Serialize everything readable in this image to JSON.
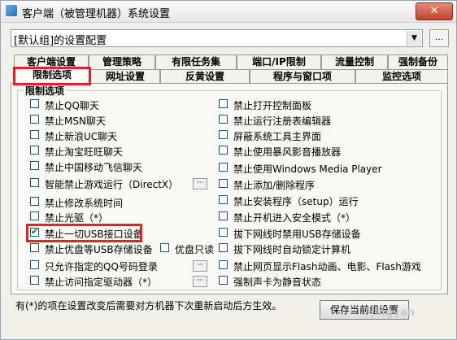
{
  "window": {
    "title": "客户端（被管理机器）系统设置",
    "close_label": "✕"
  },
  "config": {
    "selected": "[默认组]的设置配置",
    "browse_label": "..."
  },
  "tabs_row1": [
    "客户端设置",
    "管理策略",
    "有限任务集",
    "端口/IP限制",
    "流量控制",
    "强制备份"
  ],
  "tabs_row2": [
    "限制选项",
    "网址设置",
    "反黄设置",
    "程序与窗口项",
    "监控选项"
  ],
  "active_tab": "限制选项",
  "group_title": "限制选项",
  "left_options": [
    {
      "label": "禁止QQ聊天",
      "checked": false
    },
    {
      "label": "禁止MSN聊天",
      "checked": false
    },
    {
      "label": "禁止新浪UC聊天",
      "checked": false
    },
    {
      "label": "禁止淘宝旺旺聊天",
      "checked": false
    },
    {
      "label": "禁止中国移动飞信聊天",
      "checked": false
    },
    {
      "label": "智能禁止游戏运行（DirectX）",
      "checked": false
    },
    {
      "label": "禁止修改系统时间",
      "checked": false
    },
    {
      "label": "禁止光驱（*）",
      "checked": false
    },
    {
      "label": "禁止一切USB接口设备",
      "checked": true
    },
    {
      "label": "禁止优盘等USB存储设备",
      "checked": false
    },
    {
      "label": "只允许指定的QQ号码登录",
      "checked": false
    },
    {
      "label": "禁止访问指定驱动器（*）",
      "checked": false
    }
  ],
  "usb_readonly": {
    "label": "优盘只读",
    "checked": false
  },
  "right_options": [
    {
      "label": "禁止打开控制面板",
      "checked": false
    },
    {
      "label": "禁止运行注册表编辑器",
      "checked": false
    },
    {
      "label": "屏蔽系统工具主界面",
      "checked": false
    },
    {
      "label": "禁止使用暴风影音播放器",
      "checked": false
    },
    {
      "label": "禁止使用Windows Media Player",
      "checked": false
    },
    {
      "label": "禁止添加/删除程序",
      "checked": false
    },
    {
      "label": "禁止安装程序（setup）运行",
      "checked": false
    },
    {
      "label": "禁止开机进入安全模式（*）",
      "checked": false
    },
    {
      "label": "拔下网线时禁用USB存储设备",
      "checked": false
    },
    {
      "label": "拔下网线时自动锁定计算机",
      "checked": false
    },
    {
      "label": "禁止网页显示Flash动画、电影、Flash游戏",
      "checked": false
    },
    {
      "label": "强制声卡为静音状态",
      "checked": false
    }
  ],
  "footnote": "有(*)的项在设置改变后需要对方机器下次重新启动后方生效。",
  "save_button": "保存当前组设置",
  "watermark": "jingyan",
  "colors": {
    "highlight": "#e8202a",
    "accent": "#2a6cb8"
  }
}
